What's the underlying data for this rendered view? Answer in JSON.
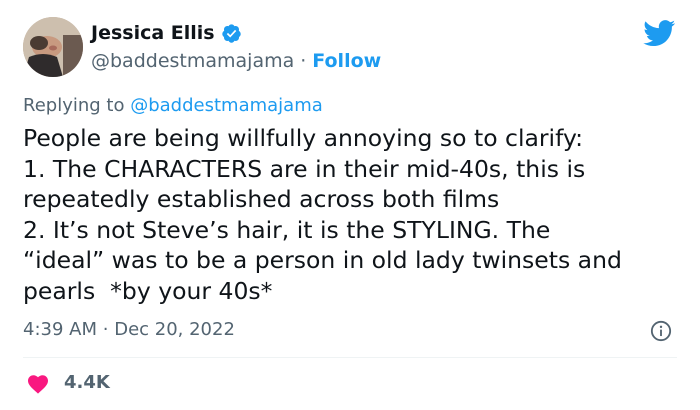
{
  "colors": {
    "accent": "#1d9bf0",
    "text": "#0f1419",
    "secondary_text": "#536471",
    "heart": "#f91880",
    "divider": "#eff3f4"
  },
  "author": {
    "display_name": "Jessica Ellis",
    "handle": "@baddestmamajama",
    "separator": "·",
    "follow_label": "Follow",
    "verified_icon": "verified-badge-icon",
    "avatar": "profile-photo"
  },
  "brand_icon": "twitter-bird-icon",
  "reply": {
    "prefix": "Replying to",
    "handle": "@baddestmamajama"
  },
  "body": {
    "lines": [
      "People are being willfully annoying so to clarify:",
      "1. The CHARACTERS are in their mid-40s, this is",
      "repeatedly established across both films",
      "2. It’s not Steve’s hair, it is the STYLING. The",
      "“ideal” was to be a person in old lady twinsets and",
      "pearls  *by your 40s*"
    ]
  },
  "meta": {
    "time": "4:39 AM",
    "separator": "·",
    "date": "Dec 20, 2022",
    "info_icon": "info-icon"
  },
  "engagement": {
    "like_icon": "heart-icon",
    "like_count": "4.4K"
  }
}
